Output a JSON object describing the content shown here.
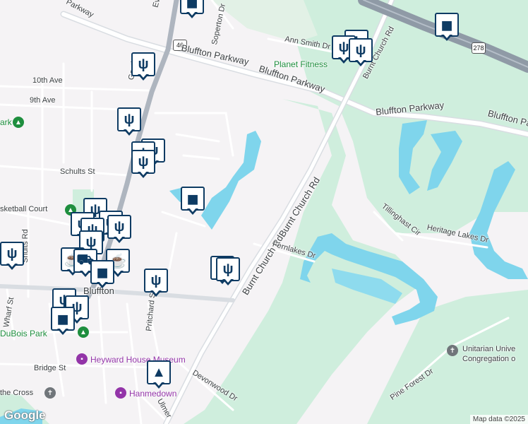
{
  "labels": {
    "ann_smith": "Ann Smith Dr",
    "burnt_church_top": "Burnt Church Rd",
    "ave10": "10th Ave",
    "ave9": "9th Ave",
    "bluffton_pkwy_1": "Bluffton Parkway",
    "bluffton_pkwy_2": "Bluffton Parkway",
    "bluffton_pkwy_3": "Bluffton Parkway",
    "bluffton_pkwy_4": "Bluffton Parkway",
    "parkway_nw": "Parkway",
    "soperton": "Soperton Dr",
    "schults_st": "Schults St",
    "shults_rd": "Shults Rd",
    "burnt_church_mid1": "Burnt Church Rd",
    "burnt_church_mid2": "Burnt Church Rd",
    "fernlakes": "Fernlakes Dr",
    "tillinghast": "Tillinghast Cir",
    "heritage_lakes": "Heritage Lakes Dr",
    "pritchard": "Pritchard St",
    "bluffton": "Bluffton",
    "bridge_st": "Bridge St",
    "devonwood": "Devonwood Dr",
    "pine_forest": "Pine Forest Dr",
    "wharf": "Wharf St",
    "goethe": "Goethe",
    "everest": "Eve",
    "ulmer": "Ulmer",
    "basketball": "sketball Court",
    "park_left": "ark",
    "planet_fitness": "Planet Fitness",
    "dubois": "DuBois Park",
    "heyward": "Heyward House Museum",
    "hanmedown": "Hanmedown",
    "the_cross": "the Cross",
    "unitarian1": "Unitarian Unive",
    "unitarian2": "Congregation o",
    "r46": "46",
    "r278": "278"
  },
  "markers": {
    "restaurant": "restaurant-icon",
    "shopping": "shopping-bag-icon",
    "cart": "shopping-cart-icon",
    "cafe": "cafe-icon",
    "school": "school-icon"
  },
  "colors": {
    "land": "#f5f3f5",
    "green": "#cfeedd",
    "water": "#7fd5ec",
    "road": "#ffffff",
    "highway": "#8f9aa6",
    "marker_border": "#0e3b63"
  },
  "brand": "Google",
  "attribution": "Map data ©2025"
}
